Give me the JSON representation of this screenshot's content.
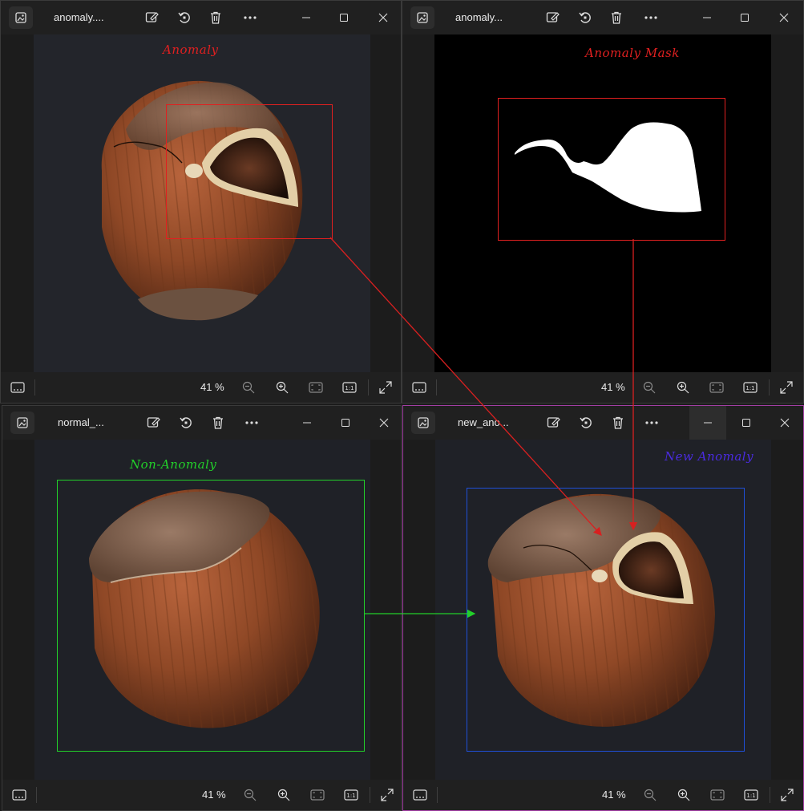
{
  "windows": [
    {
      "id": "anomaly",
      "title": "anomaly....",
      "zoom": "41 %",
      "annotation": "Anomaly",
      "annotation_color": "#e02020",
      "box_color": "#e02020"
    },
    {
      "id": "anomaly-mask",
      "title": "anomaly...",
      "zoom": "41 %",
      "annotation": "Anomaly Mask",
      "annotation_color": "#e02020",
      "box_color": "#e02020"
    },
    {
      "id": "normal",
      "title": "normal_...",
      "zoom": "41 %",
      "annotation": "Non-Anomaly",
      "annotation_color": "#22d02a",
      "box_color": "#22d02a"
    },
    {
      "id": "new-anomaly",
      "title": "new_ano...",
      "zoom": "41 %",
      "annotation": "New Anomaly",
      "annotation_color": "#4a2be0",
      "box_color": "#1f4fd8"
    }
  ],
  "arrows": [
    {
      "from": "anomaly",
      "to": "new-anomaly",
      "color": "#d82020"
    },
    {
      "from": "anomaly-mask",
      "to": "new-anomaly",
      "color": "#d82020"
    },
    {
      "from": "normal",
      "to": "new-anomaly",
      "color": "#22d02a"
    }
  ],
  "icons": {
    "app": "photo-app-icon",
    "toolbar": [
      "edit-image-icon",
      "rotate-icon",
      "delete-icon",
      "more-icon"
    ],
    "window_controls": [
      "minimize-icon",
      "maximize-icon",
      "close-icon"
    ],
    "statusbar": [
      "filmstrip-icon",
      "zoom-out-icon",
      "zoom-in-icon",
      "fit-to-window-icon",
      "actual-size-icon",
      "fullscreen-icon"
    ]
  },
  "actual_size_label": "1:1"
}
